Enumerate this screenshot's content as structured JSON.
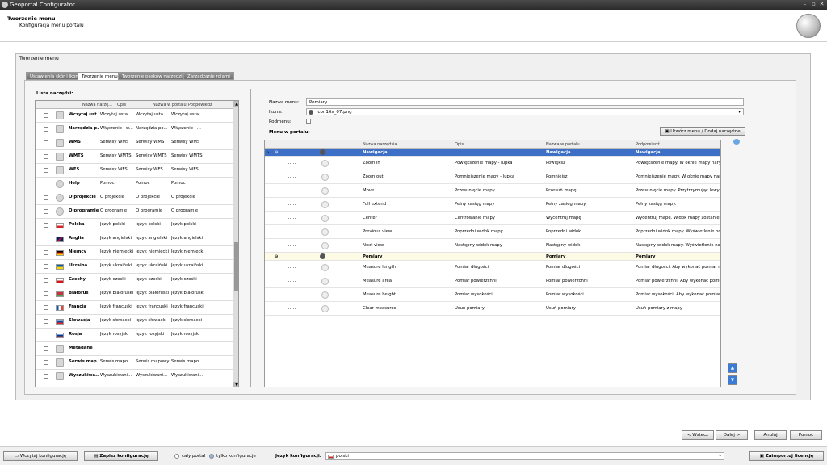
{
  "window": {
    "title": "Geoportal Configurator"
  },
  "header": {
    "title": "Tworzenie menu",
    "subtitle": "Konfiguracja menu portalu"
  },
  "panel": {
    "title": "Tworzenie menu"
  },
  "tabs": [
    {
      "label": "Ustawienia skór i ikon"
    },
    {
      "label": "Tworzenie menu"
    },
    {
      "label": "Tworzenie pasków narzędzi"
    },
    {
      "label": "Zarządzanie rolami"
    }
  ],
  "tools": {
    "label": "Lista narzędzi:",
    "columns": [
      "Nazwa narzę...",
      "Opis",
      "Nazwa w portalu",
      "Podpowiedź"
    ],
    "rows": [
      {
        "icon": "load-icon",
        "name": "Wczytaj ust...",
        "desc": "Wczytaj usta...",
        "portal": "Wczytaj usta...",
        "hint": "Wczytaj usta..."
      },
      {
        "icon": "tools-icon",
        "name": "Narzędzia p...",
        "desc": "Włączenie i w...",
        "portal": "Narzędzia po...",
        "hint": "Włączenie i ..."
      },
      {
        "icon": "wms-icon",
        "name": "WMS",
        "desc": "Serwisy WMS",
        "portal": "Serwisy WMS",
        "hint": "Serwisy WMS"
      },
      {
        "icon": "wmts-icon",
        "name": "WMTS",
        "desc": "Serwisy WMTS",
        "portal": "Serwisy WMTS",
        "hint": "Serwisy WMTS"
      },
      {
        "icon": "wfs-icon",
        "name": "WFS",
        "desc": "Serwisy WFS",
        "portal": "Serwisy WFS",
        "hint": "Serwisy WFS"
      },
      {
        "icon": "help-icon",
        "name": "Help",
        "desc": "Pomoc",
        "portal": "Pomoc",
        "hint": "Pomoc"
      },
      {
        "icon": "info-icon",
        "name": "O projekcie",
        "desc": "O projekcie",
        "portal": "O projekcie",
        "hint": "O projekcie"
      },
      {
        "icon": "info-icon",
        "name": "O programie",
        "desc": "O programie",
        "portal": "O programie",
        "hint": "O programie"
      },
      {
        "icon": "flag-pl-icon",
        "name": "Polska",
        "desc": "Język polski",
        "portal": "Język polski",
        "hint": "Język polski"
      },
      {
        "icon": "flag-uk-icon",
        "name": "Anglia",
        "desc": "Język angielski",
        "portal": "Język angielski",
        "hint": "Język angielski"
      },
      {
        "icon": "flag-de-icon",
        "name": "Niemcy",
        "desc": "Język niemiecki",
        "portal": "Język niemiecki",
        "hint": "Język niemiecki"
      },
      {
        "icon": "flag-ua-icon",
        "name": "Ukraina",
        "desc": "Język ukraiński",
        "portal": "Język ukraiński",
        "hint": "Język ukraiński"
      },
      {
        "icon": "flag-cz-icon",
        "name": "Czechy",
        "desc": "Język czeski",
        "portal": "Język czeski",
        "hint": "Język czeski"
      },
      {
        "icon": "flag-by-icon",
        "name": "Białorus",
        "desc": "Język białoruski",
        "portal": "Język białoruski",
        "hint": "Język białoruski"
      },
      {
        "icon": "flag-fr-icon",
        "name": "Francja",
        "desc": "Język francuski",
        "portal": "Język francuski",
        "hint": "Język francuski"
      },
      {
        "icon": "flag-sk-icon",
        "name": "Słowacja",
        "desc": "Język słowacki",
        "portal": "Język słowacki",
        "hint": "Język słowacki"
      },
      {
        "icon": "flag-ru-icon",
        "name": "Rosja",
        "desc": "Język rosyjski",
        "portal": "Język rosyjski",
        "hint": "Język rosyjski"
      },
      {
        "icon": "doc-icon",
        "name": "Metadane",
        "desc": "",
        "portal": "",
        "hint": ""
      },
      {
        "icon": "map-service-icon",
        "name": "Serwis map...",
        "desc": "Serwis mapo...",
        "portal": "Serwis mapowy",
        "hint": "Serwis mapo..."
      },
      {
        "icon": "search-icon",
        "name": "Wyszukiwa...",
        "desc": "Wyszukiwani...",
        "portal": "Wyszukiwani...",
        "hint": "Wyszukiwani..."
      }
    ]
  },
  "form": {
    "name_label": "Nazwa menu:",
    "name_value": "Pomiary",
    "icon_label": "Ikona:",
    "icon_value": "icon16x_07.png",
    "submenu_label": "Podmenu:",
    "menu_label": "Menu w portalu:",
    "create_button": "Utwórz menu / Dodaj narzędzie"
  },
  "menu": {
    "columns": [
      "Nazwa narzędzia",
      "Opis",
      "Nazwa w portalu",
      "Podpowiedź"
    ],
    "groups": [
      {
        "name": "Nawigacja",
        "portal": "Nawigacja",
        "hint": "Nawigacja",
        "selected": true,
        "items": [
          {
            "icon": "zoom-in-icon",
            "name": "Zoom in",
            "desc": "Powiększenie mapy - lupka",
            "portal": "Powiększ",
            "hint": "Powiększenie mapy. W oknie mapy nary..."
          },
          {
            "icon": "zoom-out-icon",
            "name": "Zoom out",
            "desc": "Pomniejszenie mapy - lupka",
            "portal": "Pomniejsz",
            "hint": "Pomniejszenie mapy. W oknie mapy nar..."
          },
          {
            "icon": "move-icon",
            "name": "Move",
            "desc": "Przesunięcie mapy",
            "portal": "Przesuń mapę",
            "hint": "Przesunięcie mapy. Przytrzymując lewy ..."
          },
          {
            "icon": "full-extent-icon",
            "name": "Full extend",
            "desc": "Pełny zasięg mapy",
            "portal": "Pełny zasięg mapy",
            "hint": "Pełny zasięg mapy."
          },
          {
            "icon": "center-icon",
            "name": "Center",
            "desc": "Centrowanie mapy",
            "portal": "Wycentruj mapę",
            "hint": "Wycentruj mapę. Widok mapy zostanie ..."
          },
          {
            "icon": "previous-view-icon",
            "name": "Previous view",
            "desc": "Poprzedni widok mapy",
            "portal": "Poprzedni widok",
            "hint": "Poprzedni widok mapy. Wyświetlenie po..."
          },
          {
            "icon": "next-view-icon",
            "name": "Next view",
            "desc": "Następny widok mapy",
            "portal": "Następny widok",
            "hint": "Następny widok mapy. Wyświetlenie na..."
          }
        ]
      },
      {
        "name": "Pomiary",
        "portal": "Pomiary",
        "hint": "Pomiary",
        "selected": false,
        "items": [
          {
            "icon": "measure-length-icon",
            "name": "Measure length",
            "desc": "Pomiar długości",
            "portal": "Pomiar długości",
            "hint": "Pomiar długości. Aby wykonać pomiar n..."
          },
          {
            "icon": "measure-area-icon",
            "name": "Measure area",
            "desc": "Pomiar powierzchni",
            "portal": "Pomiar powierzchni",
            "hint": "Pomiar powierzchni. Aby wykonać pomia..."
          },
          {
            "icon": "measure-height-icon",
            "name": "Measure height",
            "desc": "Pomiar wysokości",
            "portal": "Pomiar wysokości",
            "hint": "Pomiar wysokości. Aby wykonać pomiar..."
          },
          {
            "icon": "clear-measures-icon",
            "name": "Clear measures",
            "desc": "Usuń pomiary",
            "portal": "Usuń pomiary",
            "hint": "Usuń pomiary z mapy"
          }
        ]
      }
    ]
  },
  "nav": {
    "back": "< Wstecz",
    "next": "Dalej >",
    "cancel": "Anuluj",
    "help": "Pomoc"
  },
  "footer": {
    "load_button": "Wczytaj konfigurację",
    "save_button": "Zapisz konfigurację",
    "radio_all": "cały portal",
    "radio_config": "tylko konfiguracje",
    "lang_label": "Język konfiguracji:",
    "lang_value": "polski",
    "import_button": "Zaimportuj licencję"
  },
  "colors": {
    "selection": "#3d6fc6",
    "group_row": "#fdfbe6",
    "accent_arrow": "#3a7bd5"
  }
}
